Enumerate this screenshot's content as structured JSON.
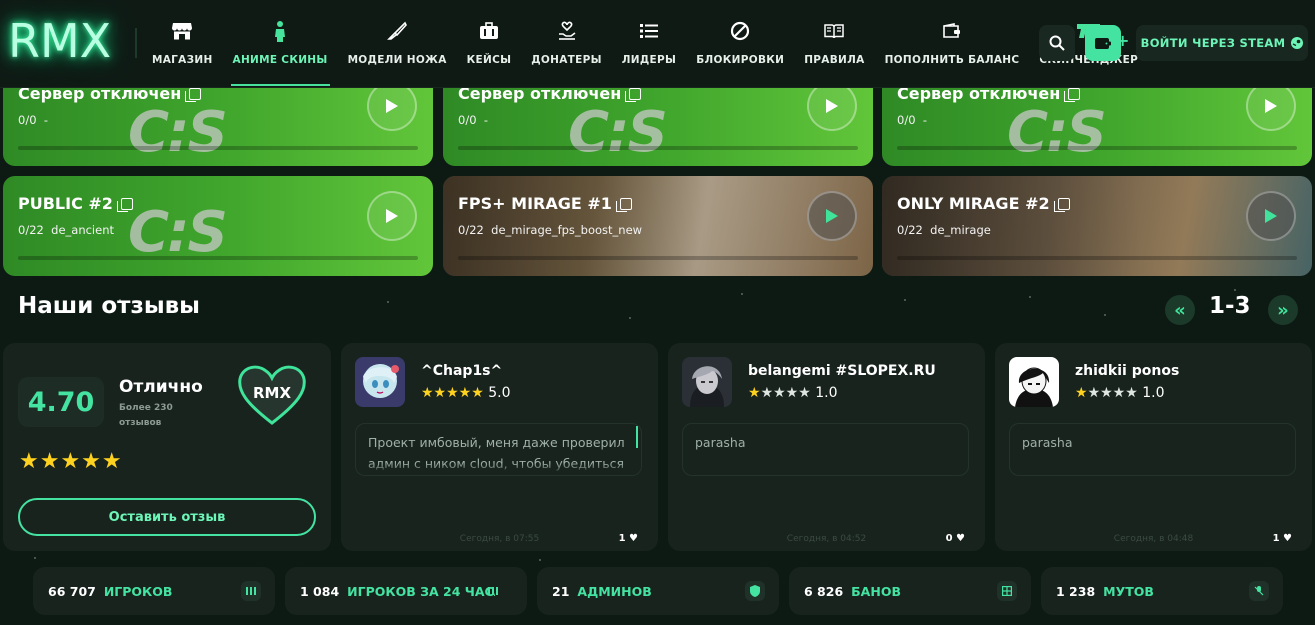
{
  "header": {
    "logo": "RMX",
    "nav": [
      {
        "label": "МАГАЗИН",
        "icon": "store-icon"
      },
      {
        "label": "АНИМЕ СКИНЫ",
        "icon": "figure-icon",
        "active": true
      },
      {
        "label": "МОДЕЛИ НОЖА",
        "icon": "knife-icon"
      },
      {
        "label": "КЕЙСЫ",
        "icon": "case-icon"
      },
      {
        "label": "ДОНАТЕРЫ",
        "icon": "donate-icon"
      },
      {
        "label": "ЛИДЕРЫ",
        "icon": "list-icon"
      },
      {
        "label": "БЛОКИРОВКИ",
        "icon": "ban-icon"
      },
      {
        "label": "ПРАВИЛА",
        "icon": "book-icon"
      },
      {
        "label": "ПОПОЛНИТЬ БАЛАНС",
        "icon": "wallet-icon"
      },
      {
        "label": "СКИНЧЕНДЖЕР",
        "icon": "gun-icon"
      }
    ],
    "wallet_plus": "+",
    "steam_login": "ВОЙТИ ЧЕРЕЗ STEAM"
  },
  "servers": [
    {
      "title": "Сервер отключен",
      "players": "0/0",
      "map": "-",
      "logo_text": "C:S",
      "style": "green"
    },
    {
      "title": "Сервер отключен",
      "players": "0/0",
      "map": "-",
      "logo_text": "C:S",
      "style": "green"
    },
    {
      "title": "Сервер отключен",
      "players": "0/0",
      "map": "-",
      "logo_text": "C:S",
      "style": "green"
    },
    {
      "title": "PUBLIC #2",
      "players": "0/22",
      "map": "de_ancient",
      "logo_text": "C:S",
      "style": "green"
    },
    {
      "title": "FPS+ MIRAGE #1",
      "players": "0/22",
      "map": "de_mirage_fps_boost_new",
      "style": "image"
    },
    {
      "title": "ONLY MIRAGE #2",
      "players": "0/22",
      "map": "de_mirage",
      "style": "image"
    }
  ],
  "reviews_section": {
    "title": "Наши отзывы",
    "pager": "1-3",
    "prev": "«",
    "next": "»"
  },
  "rating": {
    "score": "4.70",
    "label": "Отлично",
    "sub": "Более 230 отзывов",
    "stars": "★★★★★",
    "button": "Оставить отзыв",
    "logo_text": "RMX"
  },
  "reviews": [
    {
      "name": "^Chap1s^",
      "stars_on": "★★★★★",
      "stars_off": "",
      "score": "5.0",
      "text": "Проект имбовый, меня даже проверил админ с ником cloud, чтобы убедиться что я не читер. Т",
      "date": "Сегодня, в 07:55",
      "likes": "1"
    },
    {
      "name": "belangemi #SLOPEX.RU",
      "stars_on": "★",
      "stars_off": "★★★★",
      "score": "1.0",
      "text": "parasha",
      "date": "Сегодня, в 04:52",
      "likes": "0"
    },
    {
      "name": "zhidkii ponos",
      "stars_on": "★",
      "stars_off": "★★★★",
      "score": "1.0",
      "text": "parasha",
      "date": "Сегодня, в 04:48",
      "likes": "1"
    }
  ],
  "stats": [
    {
      "num": "66 707",
      "label": "ИГРОКОВ",
      "icon": "players-icon"
    },
    {
      "num": "1 084",
      "label": "ИГРОКОВ ЗА 24 ЧАСА",
      "icon": "players-day-icon"
    },
    {
      "num": "21",
      "label": "АДМИНОВ",
      "icon": "shield-icon"
    },
    {
      "num": "6 826",
      "label": "БАНОВ",
      "icon": "ban-grid-icon"
    },
    {
      "num": "1 238",
      "label": "МУТОВ",
      "icon": "mute-icon"
    }
  ]
}
